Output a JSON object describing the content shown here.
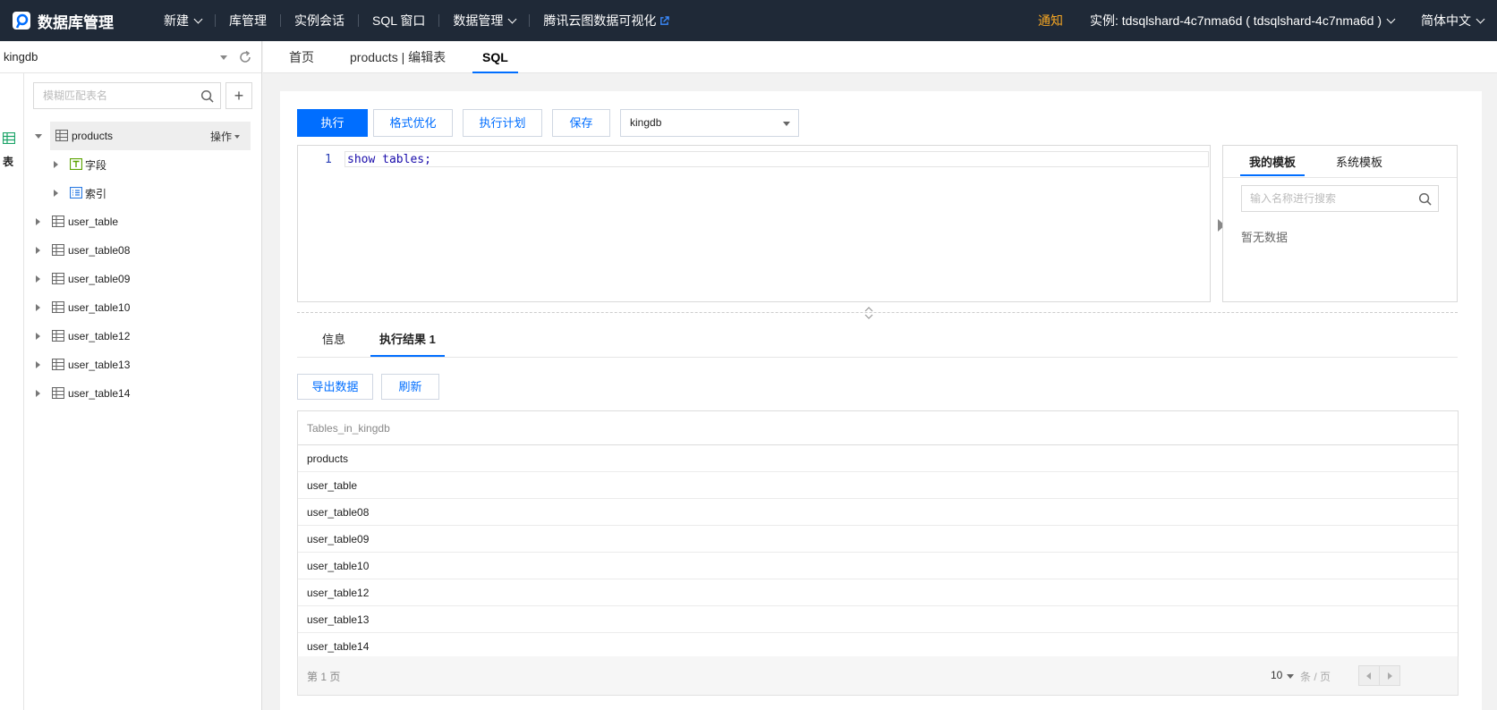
{
  "nav": {
    "brand": "数据库管理",
    "items": [
      {
        "label": "新建",
        "dropdown": true
      },
      {
        "label": "库管理",
        "dropdown": false
      },
      {
        "label": "实例会话",
        "dropdown": false
      },
      {
        "label": "SQL 窗口",
        "dropdown": false
      },
      {
        "label": "数据管理",
        "dropdown": true
      },
      {
        "label": "腾讯云图数据可视化",
        "dropdown": false
      }
    ],
    "notice": "通知",
    "instance": "实例: tdsqlshard-4c7nma6d ( tdsqlshard-4c7nma6d )",
    "language": "简体中文"
  },
  "sidebar": {
    "database": "kingdb",
    "rail_label": "表",
    "search_placeholder": "模糊匹配表名",
    "add_label": "+",
    "tree": {
      "expanded_table": "products",
      "operation_label": "操作",
      "children": [
        "字段",
        "索引"
      ],
      "tables": [
        "user_table",
        "user_table08",
        "user_table09",
        "user_table10",
        "user_table12",
        "user_table13",
        "user_table14"
      ]
    }
  },
  "tabs": [
    "首页",
    "products | 编辑表",
    "SQL"
  ],
  "toolbar": {
    "execute": "执行",
    "format": "格式优化",
    "plan": "执行计划",
    "save": "保存",
    "database": "kingdb"
  },
  "editor": {
    "line_number": "1",
    "code": "show tables;"
  },
  "templates": {
    "tabs": [
      "我的模板",
      "系统模板"
    ],
    "search_placeholder": "输入名称进行搜索",
    "empty": "暂无数据"
  },
  "result": {
    "tabs": [
      "信息",
      "执行结果 1"
    ],
    "export": "导出数据",
    "refresh": "刷新",
    "column": "Tables_in_kingdb",
    "rows": [
      "products",
      "user_table",
      "user_table08",
      "user_table09",
      "user_table10",
      "user_table12",
      "user_table13",
      "user_table14"
    ],
    "page_label": "第 1 页",
    "page_size": "10",
    "page_unit": "条 / 页"
  },
  "colors": {
    "nav_bg": "#1f2937",
    "accent": "#006eff",
    "notice": "#f5a623"
  }
}
